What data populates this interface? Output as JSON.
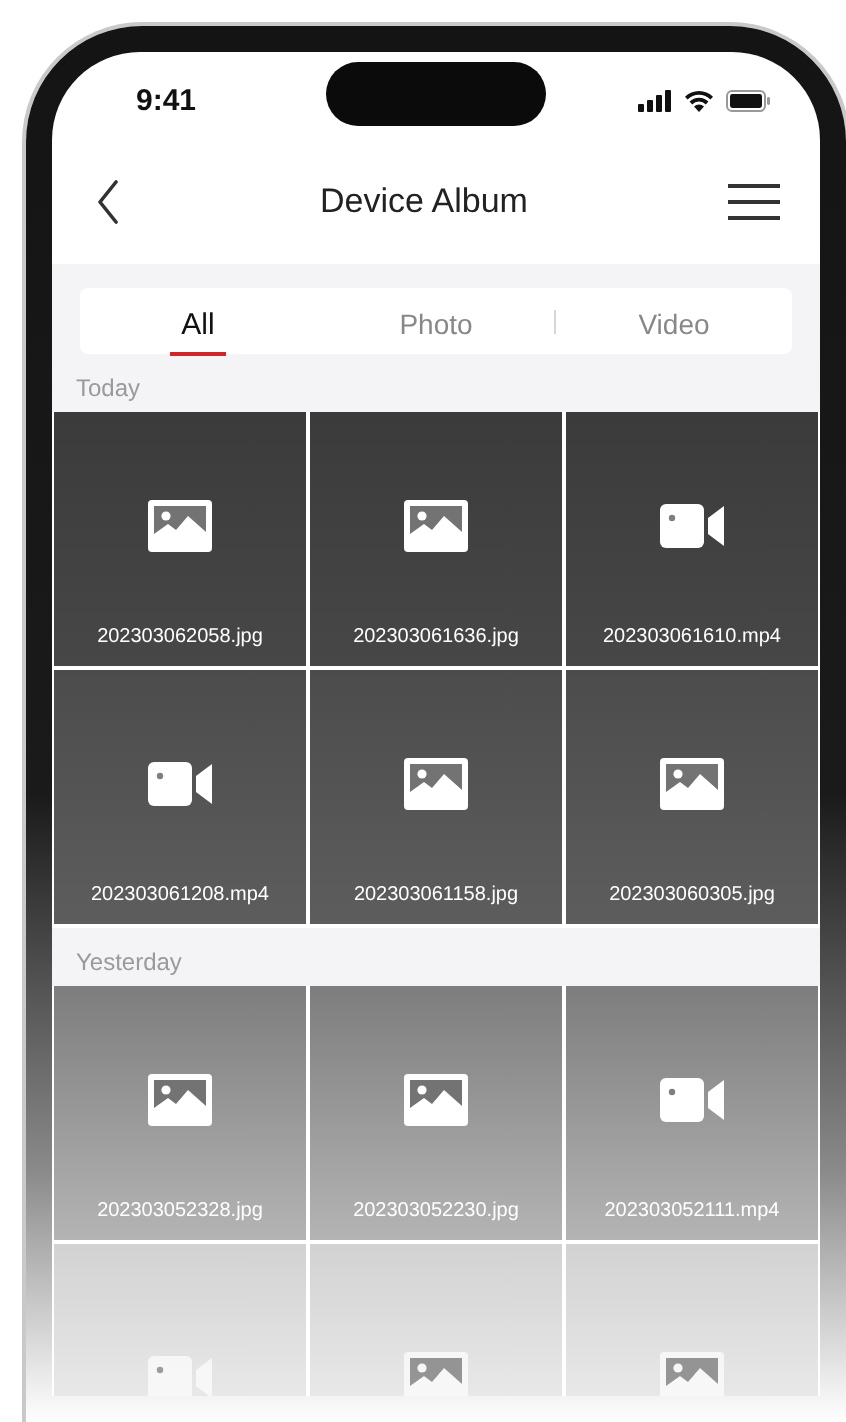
{
  "status_bar": {
    "time": "9:41"
  },
  "nav": {
    "title": "Device Album"
  },
  "tabs": [
    {
      "label": "All",
      "selected": true
    },
    {
      "label": "Photo",
      "selected": false
    },
    {
      "label": "Video",
      "selected": false
    }
  ],
  "sections": [
    {
      "heading": "Today",
      "items": [
        {
          "kind": "photo",
          "name": "202303062058.jpg"
        },
        {
          "kind": "photo",
          "name": "202303061636.jpg"
        },
        {
          "kind": "video",
          "name": "202303061610.mp4"
        },
        {
          "kind": "video",
          "name": "202303061208.mp4"
        },
        {
          "kind": "photo",
          "name": "202303061158.jpg"
        },
        {
          "kind": "photo",
          "name": "202303060305.jpg"
        }
      ]
    },
    {
      "heading": "Yesterday",
      "items": [
        {
          "kind": "photo",
          "name": "202303052328.jpg"
        },
        {
          "kind": "photo",
          "name": "202303052230.jpg"
        },
        {
          "kind": "video",
          "name": "202303052111.mp4"
        },
        {
          "kind": "video"
        },
        {
          "kind": "photo"
        },
        {
          "kind": "photo"
        }
      ]
    }
  ]
}
